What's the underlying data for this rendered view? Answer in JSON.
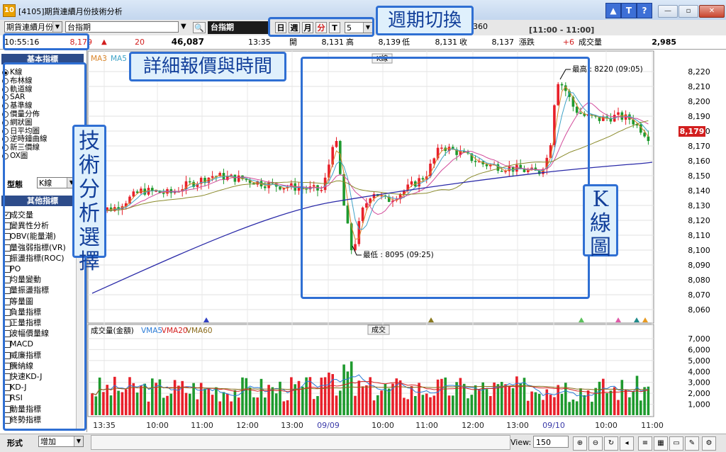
{
  "window": {
    "title": "[4105]期貨連續月份技術分析",
    "icon": "app-icon",
    "icon_glyph": "10",
    "title_buttons": [
      "▲",
      "T",
      "?"
    ],
    "win_buttons": [
      "—",
      "▫",
      "✕"
    ]
  },
  "toolbar": {
    "contract_select": "期貨連續月份",
    "underlying_input": "台指期",
    "search_icon": "🔍",
    "name_label": "台指期",
    "periods": [
      "日",
      "週",
      "月",
      "分",
      "T"
    ],
    "active_period": "分",
    "minutes_select": "5",
    "value_360": "360",
    "time_range": "[11:00 - 11:00]"
  },
  "quote": {
    "time": "10:55:16",
    "price": "8,179",
    "change": "20",
    "volume": "46,087",
    "ts": "13:35",
    "open_label": "開",
    "open": "8,131",
    "high_label": "高",
    "high": "8,139",
    "low_label": "低",
    "low": "8,131",
    "close_label": "收",
    "close": "8,137",
    "chg_label": "漲跌",
    "chg": "+6",
    "vol_label": "成交量",
    "vol": "2,985"
  },
  "left_panel": {
    "basic_header": "基本指標",
    "basic_items": [
      "K線",
      "布林線",
      "軌道線",
      "SAR",
      "基準線",
      "價量分佈",
      "網狀圖",
      "日平均圖",
      "逆時鐘曲線",
      "新三價線",
      "OX圖"
    ],
    "basic_selected": 0,
    "type_label": "型態",
    "type_value": "K線",
    "other_header": "其他指標",
    "other_items": [
      "成交量",
      "變異性分析",
      "OBV(能量潮)",
      "量強弱指標(VR)",
      "振盪指標(ROC)",
      "PO",
      "均量變動",
      "量振盪指標",
      "等量圖",
      "負量指標",
      "正量指標",
      "波幅價量線",
      "MACD",
      "威廉指標",
      "騰納線",
      "快速KD-J",
      "KD-J",
      "RSI",
      "動量指標",
      "終勢指標"
    ],
    "other_checked": 0
  },
  "price_chart": {
    "title_tag": "K線",
    "legend": [
      {
        "name": "MA3",
        "color": "#d9852a"
      },
      {
        "name": "MA5",
        "color": "#3fa3c7"
      }
    ],
    "yaxis_ticks": [
      "8,220",
      "8,210",
      "8,200",
      "8,190",
      "8,180",
      "8,170",
      "8,160",
      "8,150",
      "8,140",
      "8,130",
      "8,120",
      "8,110",
      "8,100",
      "8,090",
      "8,080",
      "8,070",
      "8,060"
    ],
    "current_price": "8,179",
    "max_label": "最高 : 8220 (09:05)",
    "min_label": "最低 : 8095 (09:25)"
  },
  "volume_chart": {
    "legend_title": "成交量(金額)",
    "legend": [
      {
        "name": "VMA5",
        "color": "#2a7bd6"
      },
      {
        "name": "VMA20",
        "color": "#d42020"
      },
      {
        "name": "VMA60",
        "color": "#8a6a1a"
      }
    ],
    "title_tag": "成交",
    "yaxis_ticks": [
      "7,000",
      "6,000",
      "5,000",
      "4,000",
      "3,000",
      "2,000",
      "1,000"
    ]
  },
  "xaxis": [
    "13:35",
    "10:00",
    "11:00",
    "12:00",
    "13:00",
    "09/09",
    "10:00",
    "11:00",
    "12:00",
    "13:00",
    "09/10",
    "10:00",
    "11:00"
  ],
  "status": {
    "form_label": "形式",
    "form_value": "增加",
    "view_label": "View:",
    "view_value": "150"
  },
  "annotations": {
    "period_switch": "週期切換",
    "quote_detail": "詳細報價與時間",
    "tech_analysis": "技術分析選擇",
    "kline_chart": "K線圖"
  },
  "colors": {
    "up": "#e8202a",
    "down": "#1e9a2e",
    "callout": "#2f6fd3"
  }
}
